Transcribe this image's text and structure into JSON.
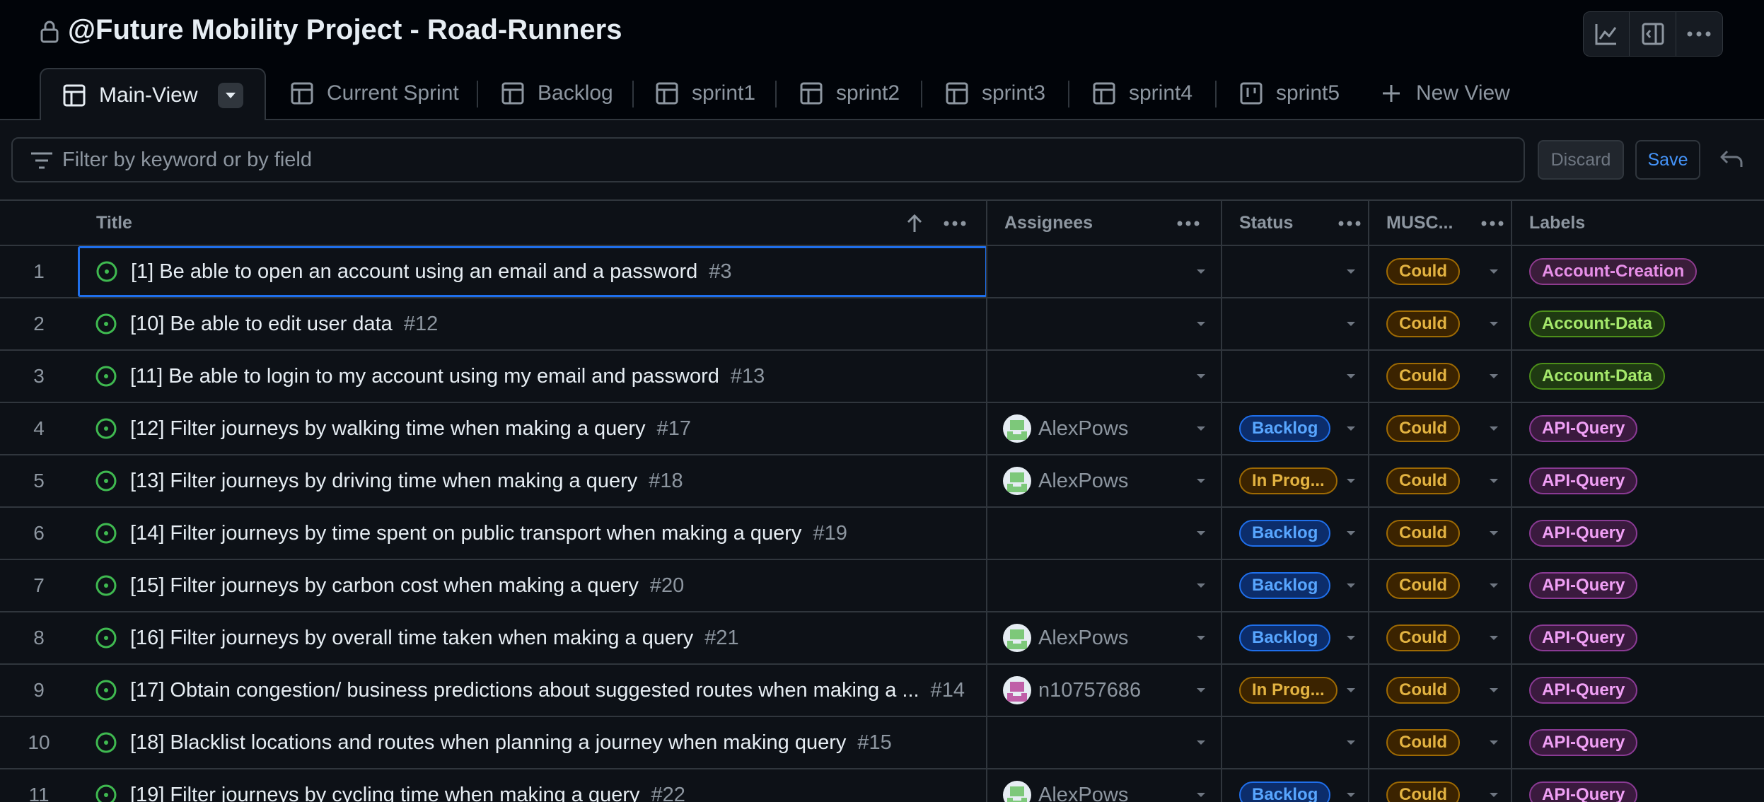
{
  "project": {
    "title": "@Future Mobility Project - Road-Runners"
  },
  "tabs": [
    {
      "label": "Main-View",
      "icon": "table-icon"
    },
    {
      "label": "Current Sprint",
      "icon": "table-icon"
    },
    {
      "label": "Backlog",
      "icon": "table-icon"
    },
    {
      "label": "sprint1",
      "icon": "table-icon"
    },
    {
      "label": "sprint2",
      "icon": "table-icon"
    },
    {
      "label": "sprint3",
      "icon": "table-icon"
    },
    {
      "label": "sprint4",
      "icon": "table-icon"
    },
    {
      "label": "sprint5",
      "icon": "board-icon"
    }
  ],
  "new_view_label": "New View",
  "filter": {
    "placeholder": "Filter by keyword or by field"
  },
  "buttons": {
    "discard": "Discard",
    "save": "Save"
  },
  "columns": {
    "title": "Title",
    "assignees": "Assignees",
    "status": "Status",
    "moscow": "MUSC...",
    "labels": "Labels"
  },
  "colors": {
    "background": "#010409",
    "accent_blue": "#1f6feb",
    "open_issue_green": "#3fb950"
  },
  "rows": [
    {
      "num": "1",
      "title": "[1] Be able to open an account using an email and a password",
      "issue": "#3",
      "assignee": "",
      "status": "",
      "moscow": "Could",
      "label": "Account-Creation",
      "label_kind": "acct-creation"
    },
    {
      "num": "2",
      "title": "[10] Be able to edit user data",
      "issue": "#12",
      "assignee": "",
      "status": "",
      "moscow": "Could",
      "label": "Account-Data",
      "label_kind": "acct-data"
    },
    {
      "num": "3",
      "title": "[11] Be able to login to my account using my email and password",
      "issue": "#13",
      "assignee": "",
      "status": "",
      "moscow": "Could",
      "label": "Account-Data",
      "label_kind": "acct-data"
    },
    {
      "num": "4",
      "title": "[12] Filter journeys by walking time when making a query",
      "issue": "#17",
      "assignee": "AlexPows",
      "avatar": "green",
      "status": "Backlog",
      "status_kind": "backlog",
      "moscow": "Could",
      "label": "API-Query",
      "label_kind": "api-query"
    },
    {
      "num": "5",
      "title": "[13] Filter journeys by driving time when making a query",
      "issue": "#18",
      "assignee": "AlexPows",
      "avatar": "green",
      "status": "In Prog...",
      "status_kind": "inprog",
      "moscow": "Could",
      "label": "API-Query",
      "label_kind": "api-query"
    },
    {
      "num": "6",
      "title": "[14] Filter journeys by time spent on public transport when making a query",
      "issue": "#19",
      "assignee": "",
      "status": "Backlog",
      "status_kind": "backlog",
      "moscow": "Could",
      "label": "API-Query",
      "label_kind": "api-query"
    },
    {
      "num": "7",
      "title": "[15] Filter journeys by carbon cost when making a query",
      "issue": "#20",
      "assignee": "",
      "status": "Backlog",
      "status_kind": "backlog",
      "moscow": "Could",
      "label": "API-Query",
      "label_kind": "api-query"
    },
    {
      "num": "8",
      "title": "[16] Filter journeys by overall time taken when making a query",
      "issue": "#21",
      "assignee": "AlexPows",
      "avatar": "green",
      "status": "Backlog",
      "status_kind": "backlog",
      "moscow": "Could",
      "label": "API-Query",
      "label_kind": "api-query"
    },
    {
      "num": "9",
      "title": "[17] Obtain congestion/ business predictions about suggested routes when making a ...",
      "issue": "#14",
      "assignee": "n10757686",
      "avatar": "pink",
      "status": "In Prog...",
      "status_kind": "inprog",
      "moscow": "Could",
      "label": "API-Query",
      "label_kind": "api-query"
    },
    {
      "num": "10",
      "title": "[18] Blacklist locations and routes when planning a journey when making query",
      "issue": "#15",
      "assignee": "",
      "status": "",
      "moscow": "Could",
      "label": "API-Query",
      "label_kind": "api-query"
    },
    {
      "num": "11",
      "title": "[19] Filter journeys by cycling time when making a query",
      "issue": "#22",
      "assignee": "AlexPows",
      "avatar": "green",
      "status": "Backlog",
      "status_kind": "backlog",
      "moscow": "Could",
      "label": "API-Query",
      "label_kind": "api-query"
    }
  ]
}
